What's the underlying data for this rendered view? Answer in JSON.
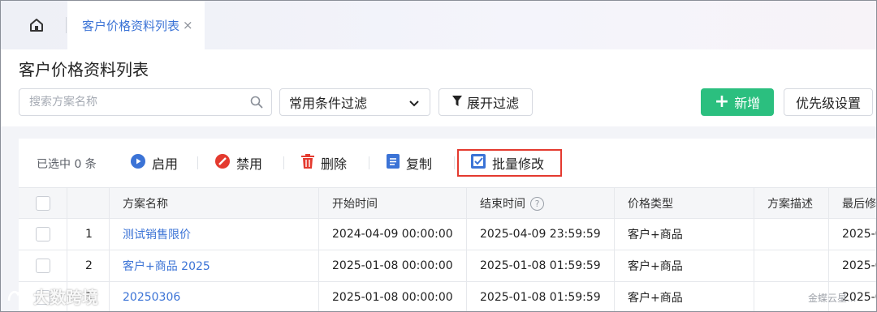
{
  "tabs": {
    "active_label": "客户价格资料列表",
    "close_glyph": "×"
  },
  "header": {
    "title": "客户价格资料列表",
    "search_placeholder": "搜索方案名称",
    "filter_select_value": "常用条件过滤",
    "expand_filter_label": "展开过滤",
    "new_label": "新增",
    "priority_label": "优先级设置"
  },
  "toolbar": {
    "selected_text": "已选中 0 条",
    "enable_label": "启用",
    "disable_label": "禁用",
    "delete_label": "删除",
    "copy_label": "复制",
    "batch_edit_label": "批量修改"
  },
  "table": {
    "columns": [
      "",
      "",
      "方案名称",
      "开始时间",
      "结束时间",
      "价格类型",
      "方案描述",
      "最后修"
    ],
    "rows": [
      {
        "index": "1",
        "name": "测试销售限价",
        "start": "2024-04-09 00:00:00",
        "end": "2025-04-09 23:59:59",
        "price_type": "客户+商品",
        "desc": "",
        "last": "2025-0"
      },
      {
        "index": "2",
        "name": "客户+商品 2025",
        "start": "2025-01-08 00:00:00",
        "end": "2025-01-08 01:59:59",
        "price_type": "客户+商品",
        "desc": "",
        "last": "2025-0"
      },
      {
        "index": "3",
        "name": "20250306",
        "start": "2025-01-08 00:00:00",
        "end": "2025-01-08 01:59:59",
        "price_type": "客户+商品",
        "desc": "",
        "last": "2025-0"
      }
    ]
  },
  "watermarks": {
    "left": "大数跨境",
    "right": "金蝶云星..."
  },
  "colors": {
    "accent": "#3b73d6",
    "new_button": "#2bbf7f",
    "disable_red": "#e43a2f",
    "highlight_border": "#e43a2f"
  }
}
